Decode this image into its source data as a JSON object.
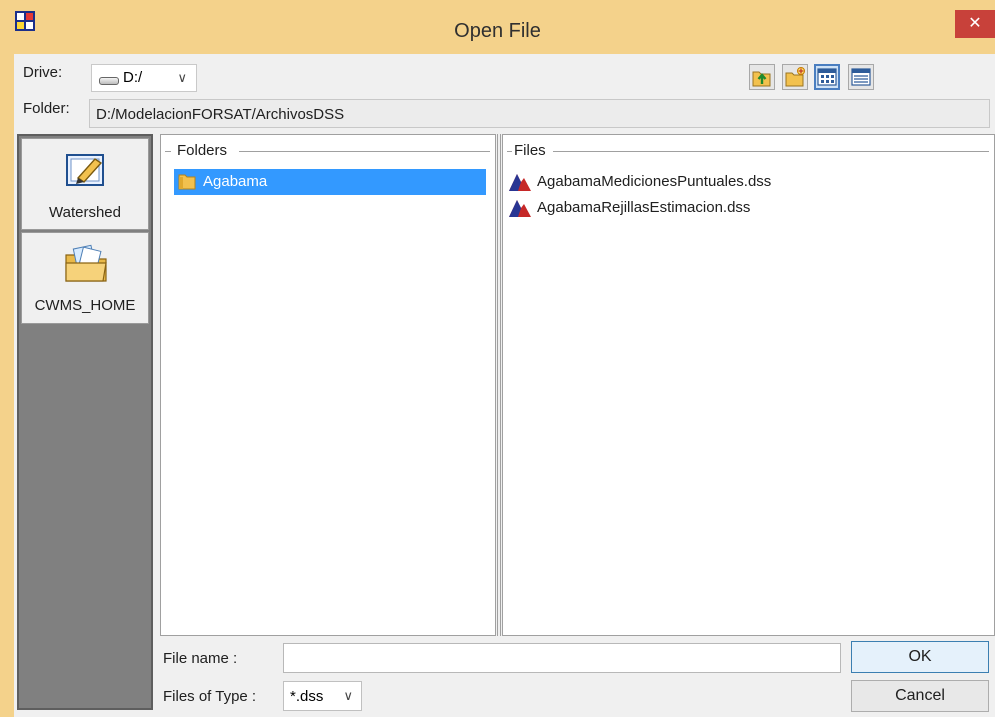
{
  "window": {
    "title": "Open File",
    "close_symbol": "✕"
  },
  "drive": {
    "label": "Drive:",
    "value": "D:/"
  },
  "toolbar": {
    "icons": [
      "up-one-level-icon",
      "new-folder-icon",
      "list-view-icon",
      "details-view-icon"
    ]
  },
  "folder": {
    "label": "Folder:",
    "path": "D:/ModelacionFORSAT/ArchivosDSS"
  },
  "places": [
    {
      "label": "Watershed",
      "icon": "watershed-icon"
    },
    {
      "label": "CWMS_HOME",
      "icon": "folder-icon"
    }
  ],
  "folders_panel": {
    "title": "Folders",
    "items": [
      "Agabama"
    ]
  },
  "files_panel": {
    "title": "Files",
    "items": [
      "AgabamaMedicionesPuntuales.dss",
      "AgabamaRejillasEstimacion.dss"
    ]
  },
  "file_name": {
    "label": "File name :",
    "value": ""
  },
  "file_type": {
    "label": "Files of Type :",
    "value": "*.dss"
  },
  "buttons": {
    "ok": "OK",
    "cancel": "Cancel"
  },
  "colors": {
    "titlebar": "#f4d28b",
    "selection": "#3399ff",
    "close": "#c8413a"
  }
}
